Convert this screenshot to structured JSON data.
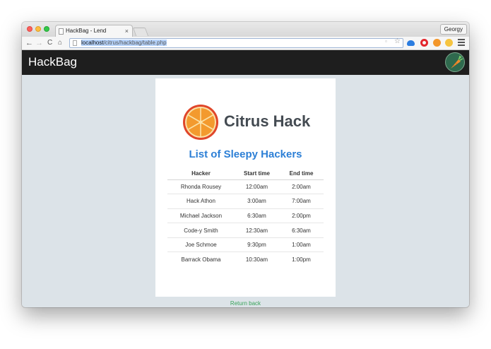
{
  "browser": {
    "tab_title": "HackBag - Lend",
    "tab_close": "×",
    "profile": "Georgy",
    "url_host": "localhost",
    "url_path": "/citrus/hackbag/table.php",
    "icons": [
      "back-arrow-icon",
      "forward-arrow-icon",
      "reload-icon",
      "home-icon",
      "page-icon",
      "bookmark-star-icon",
      "cloud-extension-icon",
      "opera-extension-icon",
      "orange-extension-icon",
      "emoji-extension-icon",
      "menu-icon"
    ]
  },
  "site": {
    "brand": "HackBag",
    "logo_text": "Citrus Hack",
    "subtitle": "List of Sleepy Hackers",
    "table": {
      "headers": [
        "Hacker",
        "Start time",
        "End time"
      ],
      "rows": [
        [
          "Rhonda Rousey",
          "12:00am",
          "2:00am"
        ],
        [
          "Hack Athon",
          "3:00am",
          "7:00am"
        ],
        [
          "Michael Jackson",
          "6:30am",
          "2:00pm"
        ],
        [
          "Code-y Smith",
          "12:30am",
          "6:30am"
        ],
        [
          "Joe Schmoe",
          "9:30pm",
          "1:00am"
        ],
        [
          "Barrack Obama",
          "10:30am",
          "1:00pm"
        ]
      ]
    },
    "return_link": "Return back"
  },
  "colors": {
    "navbar": "#1e1e1e",
    "background": "#dce3e8",
    "subtitle": "#2c7fd6",
    "link": "#3aa35b",
    "orange": "#f0922b"
  }
}
